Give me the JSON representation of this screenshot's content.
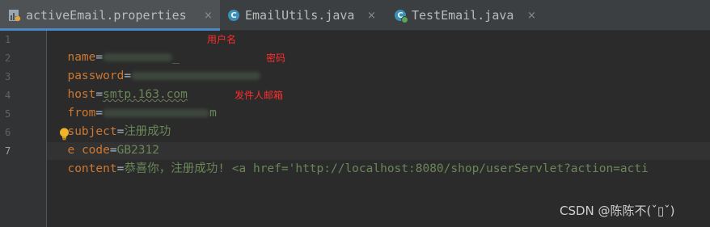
{
  "tabs": [
    {
      "label": "activeEmail.properties",
      "icon": "properties-file-icon",
      "close": "×",
      "active": true
    },
    {
      "label": "EmailUtils.java",
      "icon": "java-class-icon",
      "icon_glyph": "C",
      "close": "×",
      "active": false
    },
    {
      "label": "TestEmail.java",
      "icon": "java-runnable-class-icon",
      "icon_glyph": "C",
      "close": "×",
      "active": false
    }
  ],
  "editor": {
    "line_numbers": [
      "1",
      "2",
      "3",
      "4",
      "5",
      "6",
      "7"
    ],
    "current_line": "7",
    "lines": [
      {
        "key": "name",
        "eq": "=",
        "value": "",
        "tail": "_ "
      },
      {
        "key": "password",
        "eq": "=",
        "value": ""
      },
      {
        "key": "host",
        "eq": "=",
        "value": "smtp.163.com"
      },
      {
        "key": "from",
        "eq": "=",
        "value": "",
        "tail": "m"
      },
      {
        "key": "subject",
        "eq": "=",
        "value": "注册成功"
      },
      {
        "key": "encode",
        "key_start": "e",
        "key_end": "code",
        "eq": "=",
        "value": "GB2312"
      },
      {
        "key": "content",
        "eq": "=",
        "value": "恭喜你，注册成功! <a href='http://localhost:8080/shop/userServlet?action=acti"
      }
    ]
  },
  "annotations": {
    "name": "用户名",
    "password": "密码",
    "from": "发件人邮箱"
  },
  "colors": {
    "key": "#cc7832",
    "value": "#6a8759",
    "annotation": "#ff2d2d",
    "tab_underline": "#4a88c7"
  },
  "watermark": "CSDN @陈陈不(ˇ▯ˇ)"
}
